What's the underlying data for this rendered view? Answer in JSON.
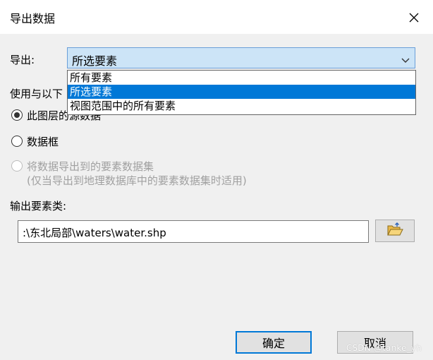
{
  "window": {
    "title": "导出数据",
    "close_icon": "close-icon"
  },
  "export": {
    "label": "导出:",
    "selected": "所选要素",
    "options": [
      "所有要素",
      "所选要素",
      "视图范围中的所有要素"
    ],
    "selected_index": 1
  },
  "coord": {
    "label_partial": "使用与以下",
    "options": [
      {
        "label_visible": "此图层的源数据",
        "checked": true,
        "enabled": true
      },
      {
        "label": "数据框",
        "checked": false,
        "enabled": true
      },
      {
        "label": "将数据导出到的要素数据集",
        "checked": false,
        "enabled": false
      }
    ],
    "note": "(仅当导出到地理数据库中的要素数据集时适用)"
  },
  "output": {
    "label": "输出要素类:",
    "path": ":\\东北局部\\waters\\water.shp",
    "browse_icon": "folder-open-icon"
  },
  "buttons": {
    "ok": "确定",
    "cancel": "取消"
  },
  "watermark": "CSDN @tanke_yh",
  "colors": {
    "accent": "#0078d7",
    "combo_bg": "#cce4f7",
    "dialog_bg": "#f0f0f0",
    "disabled_text": "#a0a0a0"
  }
}
